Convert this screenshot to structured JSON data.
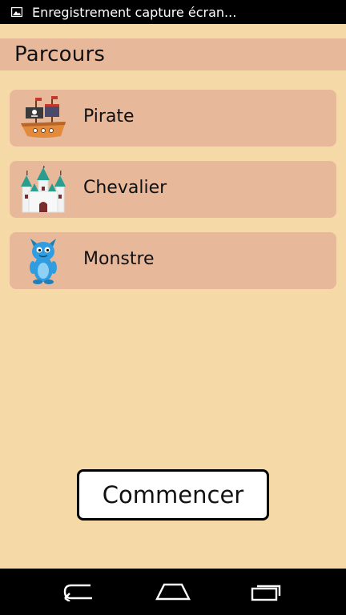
{
  "status_bar": {
    "notification_icon": "image-icon",
    "text": "Enregistrement capture écran..."
  },
  "header": {
    "title": "Parcours"
  },
  "courses": [
    {
      "label": "Pirate",
      "icon": "pirate-ship-icon"
    },
    {
      "label": "Chevalier",
      "icon": "castle-icon"
    },
    {
      "label": "Monstre",
      "icon": "monster-icon"
    }
  ],
  "start_button": {
    "label": "Commencer"
  },
  "nav_bar": {
    "back": "back-icon",
    "home": "home-icon",
    "recents": "recents-icon"
  },
  "colors": {
    "background": "#f5daa7",
    "row": "#e8b89b",
    "bars": "#000000"
  }
}
